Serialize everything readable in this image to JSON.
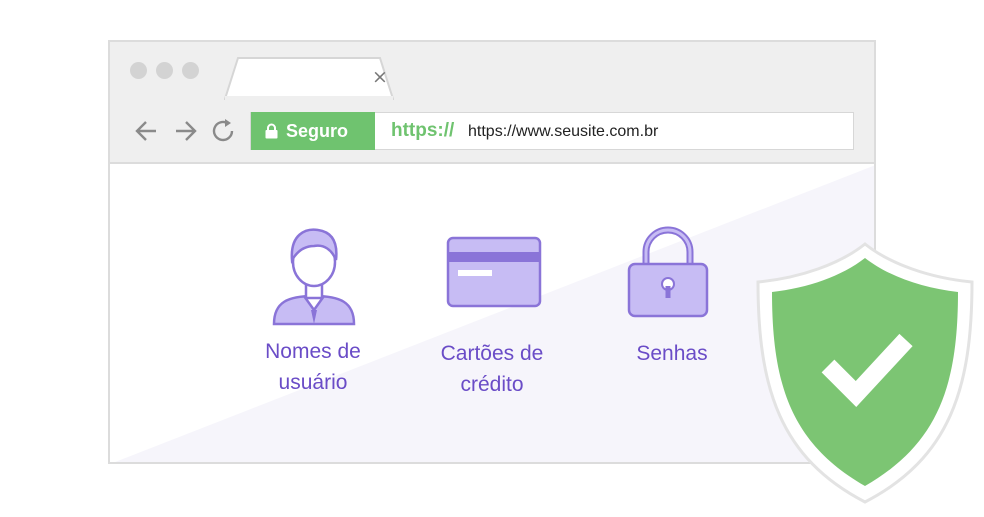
{
  "browser": {
    "tab_close_glyph": "×",
    "security_label": "Seguro",
    "url_scheme": "https://",
    "url_text": "https://www.seusite.com.br"
  },
  "features": [
    {
      "icon": "user-icon",
      "label_line1": "Nomes de",
      "label_line2": "usuário"
    },
    {
      "icon": "credit-card-icon",
      "label_line1": "Cartões de",
      "label_line2": "crédito"
    },
    {
      "icon": "padlock-icon",
      "label_line1": "Senhas",
      "label_line2": ""
    }
  ],
  "colors": {
    "accent_purple": "#6a4cc7",
    "icon_purple_light": "#c7bcf4",
    "icon_purple_dark": "#8a74d8",
    "secure_green": "#6fc36f",
    "shield_green": "#7cc573",
    "chrome_gray": "#efefef"
  }
}
